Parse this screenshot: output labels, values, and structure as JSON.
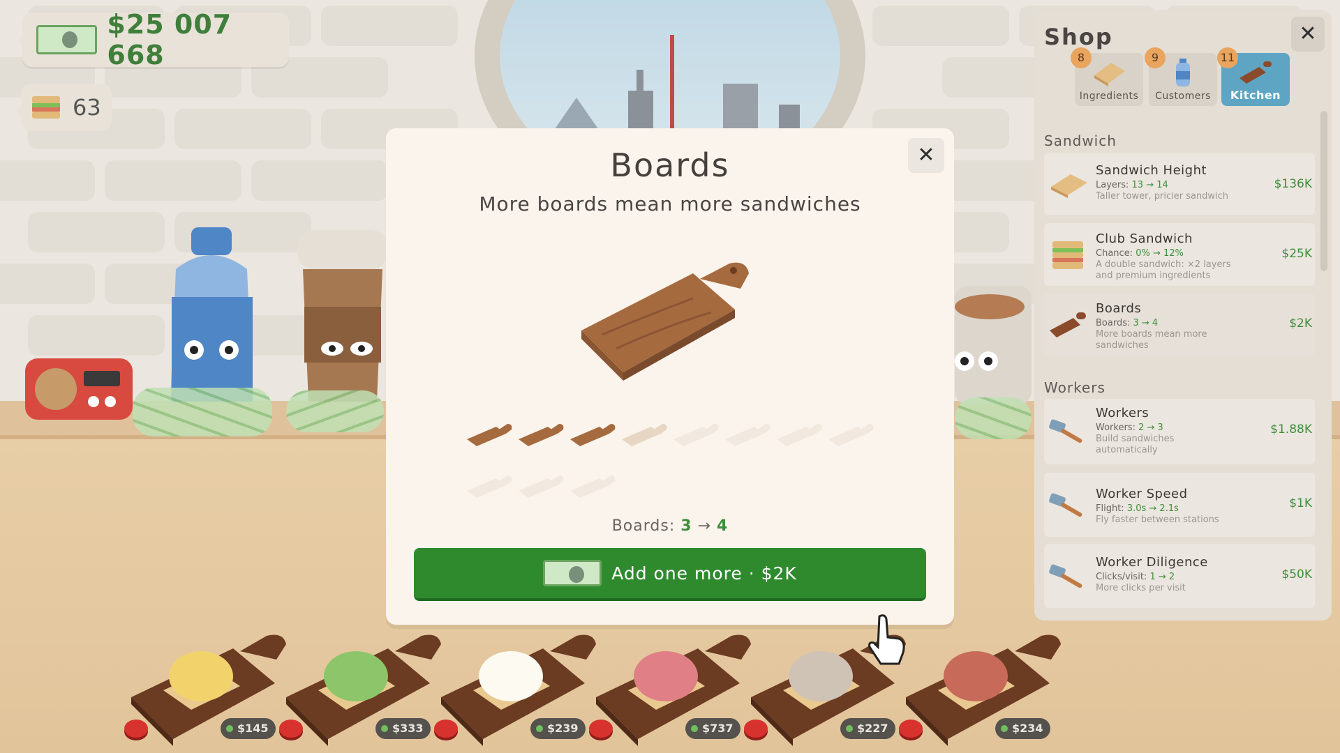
{
  "hud": {
    "money": "$25 007 668",
    "sandwich_count": "63"
  },
  "shop": {
    "title": "Shop",
    "close": "✕",
    "tabs": [
      {
        "label": "Ingredients",
        "badge": "8",
        "active": false
      },
      {
        "label": "Customers",
        "badge": "9",
        "active": false
      },
      {
        "label": "Kitchen",
        "badge": "11",
        "active": true
      }
    ],
    "sections": [
      {
        "label": "Sandwich",
        "items": [
          {
            "name": "Sandwich Height",
            "stat_prefix": "Layers: ",
            "stat_value": "13 → 14",
            "desc": "Taller tower, pricier sandwich",
            "price": "$136K"
          },
          {
            "name": "Club Sandwich",
            "stat_prefix": "Chance: ",
            "stat_value": "0% → 12%",
            "desc": "A double sandwich: ×2 layers and premium ingredients",
            "price": "$25K"
          },
          {
            "name": "Boards",
            "stat_prefix": "Boards: ",
            "stat_value": "3 → 4",
            "desc": "More boards mean more sandwiches",
            "price": "$2K"
          }
        ]
      },
      {
        "label": "Workers",
        "items": [
          {
            "name": "Workers",
            "stat_prefix": "Workers: ",
            "stat_value": "2 → 3",
            "desc": "Build sandwiches automatically",
            "price": "$1.88K"
          },
          {
            "name": "Worker Speed",
            "stat_prefix": "Flight: ",
            "stat_value": "3.0s → 2.1s",
            "desc": "Fly faster between stations",
            "price": "$1K"
          },
          {
            "name": "Worker Diligence",
            "stat_prefix": "Clicks/visit: ",
            "stat_value": "1 → 2",
            "desc": "More clicks per visit",
            "price": "$50K"
          }
        ]
      }
    ]
  },
  "modal": {
    "title": "Boards",
    "subtitle": "More boards mean more sandwiches",
    "close": "✕",
    "owned": 3,
    "total_slots": 11,
    "stat_prefix": "Boards: ",
    "stat_from": "3",
    "stat_arrow": " → ",
    "stat_to": "4",
    "buy_label": "Add one more · $2K"
  },
  "stations": [
    {
      "topping": "cheese",
      "price": "$145"
    },
    {
      "topping": "cucumber",
      "price": "$333"
    },
    {
      "topping": "egg",
      "price": "$239"
    },
    {
      "topping": "ham-stack",
      "price": "$737"
    },
    {
      "topping": "mushroom",
      "price": "$227"
    },
    {
      "topping": "bacon",
      "price": "$234"
    }
  ],
  "colors": {
    "money_green": "#3f7f3b",
    "buy_button": "#2f8a2e",
    "active_tab": "#5ea5c4",
    "badge": "#e9a45d"
  }
}
